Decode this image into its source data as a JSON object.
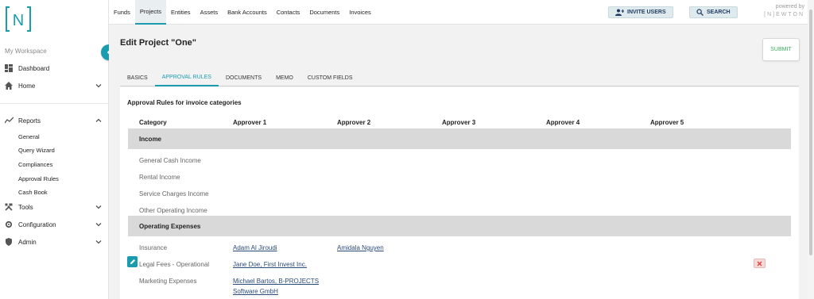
{
  "logo": {
    "text": "N"
  },
  "sidebar": {
    "workspace": "My Workspace",
    "items": [
      {
        "label": "Dashboard",
        "icon": "dashboard-icon"
      },
      {
        "label": "Home",
        "icon": "home-icon"
      },
      {
        "label": "Reports",
        "icon": "reports-icon"
      },
      {
        "label": "Tools",
        "icon": "tools-icon"
      },
      {
        "label": "Configuration",
        "icon": "gear-icon"
      },
      {
        "label": "Admin",
        "icon": "shield-icon"
      }
    ],
    "report_subitems": [
      "General",
      "Query Wizard",
      "Compliances",
      "Approval Rules",
      "Cash Book"
    ]
  },
  "topnav": {
    "items": [
      "Funds",
      "Projects",
      "Entities",
      "Assets",
      "Bank Accounts",
      "Contacts",
      "Documents",
      "Invoices"
    ],
    "active": "Projects",
    "invite_label": "INVITE USERS",
    "search_label": "SEARCH",
    "powered_by": "powered by",
    "brand": "[N]EWTON"
  },
  "page": {
    "title": "Edit Project \"One\"",
    "submit_label": "SUBMIT",
    "tabs": [
      "BASICS",
      "APPROVAL RULES",
      "DOCUMENTS",
      "MEMO",
      "CUSTOM FIELDS"
    ],
    "active_tab": "APPROVAL RULES"
  },
  "rules": {
    "heading": "Approval Rules for invoice categories",
    "columns": [
      "Category",
      "Approver 1",
      "Approver 2",
      "Approver 3",
      "Approver 4",
      "Approver 5"
    ],
    "sections": [
      {
        "name": "Income",
        "rows": [
          {
            "category": "General Cash Income"
          },
          {
            "category": "Rental Income"
          },
          {
            "category": "Service Charges Income"
          },
          {
            "category": "Other Operating Income"
          }
        ]
      },
      {
        "name": "Operating Expenses",
        "rows": [
          {
            "category": "Insurance",
            "approver1": "Adam Al Jiroudi",
            "approver2": "Amidala Nguyen"
          },
          {
            "category": "Legal Fees - Operational",
            "approver1": "Jane Doe, First Invest Inc."
          },
          {
            "category": "Marketing Expenses",
            "approver1": "Michael Bartos, B-PROJECTS Software GmbH"
          }
        ]
      }
    ]
  },
  "colors": {
    "accent": "#1a9bb0",
    "submit_text": "#3cae5e",
    "link": "#2a4a7a"
  }
}
